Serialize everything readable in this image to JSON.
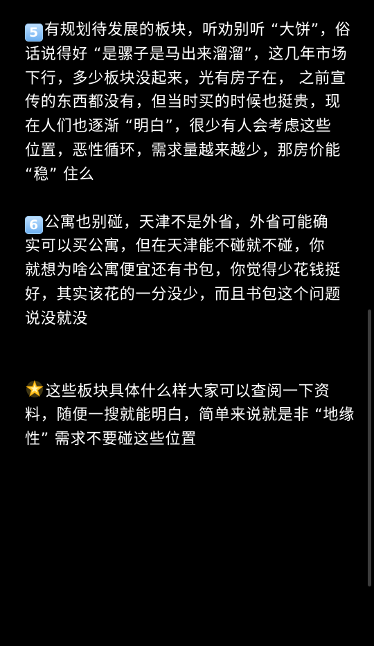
{
  "sections": [
    {
      "icon_text": "5",
      "lines": [
        "有规划待发展的板块，听劝别听 “大饼”，俗",
        "话说得好 “是骡子是马出来溜溜”，这几年市场",
        "下行，多少板块没起来，光有房子在， 之前宣",
        "传的东西都没有，但当时买的时候也挺贵，现",
        "在人们也逐渐 “明白”，很少有人会考虑这些",
        "位置，恶性循环，需求量越来越少，那房价能",
        "“稳” 住么"
      ]
    },
    {
      "icon_text": "6",
      "lines": [
        "公寓也别碰，天津不是外省，外省可能确",
        "实可以买公寓，但在天津能不碰就不碰，你",
        "就想为啥公寓便宜还有书包，你觉得少花钱挺",
        "好，其实该花的一分没少，而且书包这个问题",
        "说没就没"
      ]
    },
    {
      "icon": "glowing-star-icon",
      "lines": [
        "这些板块具体什么样大家可以查阅一下资",
        "料，随便一搜就能明白，简单来说就是非 “地缘",
        "性” 需求不要碰这些位置"
      ]
    }
  ],
  "colors": {
    "background": "#000000",
    "text": "#ffffff",
    "scrollbar": "#3c3c3c"
  }
}
